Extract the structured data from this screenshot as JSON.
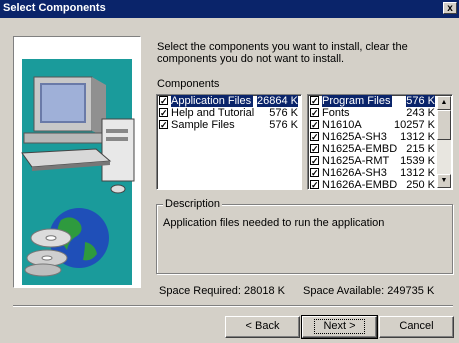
{
  "window": {
    "title": "Select Components",
    "close_glyph": "x"
  },
  "instructions": "Select the components you want to install, clear the components you do not want to install.",
  "components_label": "Components",
  "left_list": [
    {
      "name": "Application Files",
      "size": "26864 K",
      "checked": true,
      "selected": true
    },
    {
      "name": "Help and Tutorial",
      "size": "576 K",
      "checked": true,
      "selected": false
    },
    {
      "name": "Sample Files",
      "size": "576 K",
      "checked": true,
      "selected": false
    }
  ],
  "right_list": [
    {
      "name": "Program Files",
      "size": "576 K",
      "checked": true,
      "selected": true
    },
    {
      "name": "Fonts",
      "size": "243 K",
      "checked": true,
      "selected": false
    },
    {
      "name": "N1610A",
      "size": "10257 K",
      "checked": true,
      "selected": false
    },
    {
      "name": "N1625A-SH3",
      "size": "1312 K",
      "checked": true,
      "selected": false
    },
    {
      "name": "N1625A-EMBD",
      "size": "215 K",
      "checked": true,
      "selected": false
    },
    {
      "name": "N1625A-RMT",
      "size": "1539 K",
      "checked": true,
      "selected": false
    },
    {
      "name": "N1626A-SH3",
      "size": "1312 K",
      "checked": true,
      "selected": false
    },
    {
      "name": "N1626A-EMBD",
      "size": "250 K",
      "checked": true,
      "selected": false
    }
  ],
  "description": {
    "title": "Description",
    "text": "Application files needed to run the application"
  },
  "space_required": "Space Required:  28018 K",
  "space_available": "Space Available:  249735 K",
  "buttons": {
    "back": "< Back",
    "next": "Next >",
    "cancel": "Cancel"
  },
  "colors": {
    "title_bar": "#0a246a",
    "face": "#d4d0c8",
    "selection": "#0a246a",
    "art_teal": "#1a9b9b"
  },
  "icons": [
    "computer-icon",
    "cd-icon",
    "globe-icon",
    "checkbox-icon",
    "scroll-up-icon",
    "scroll-down-icon",
    "close-icon"
  ]
}
